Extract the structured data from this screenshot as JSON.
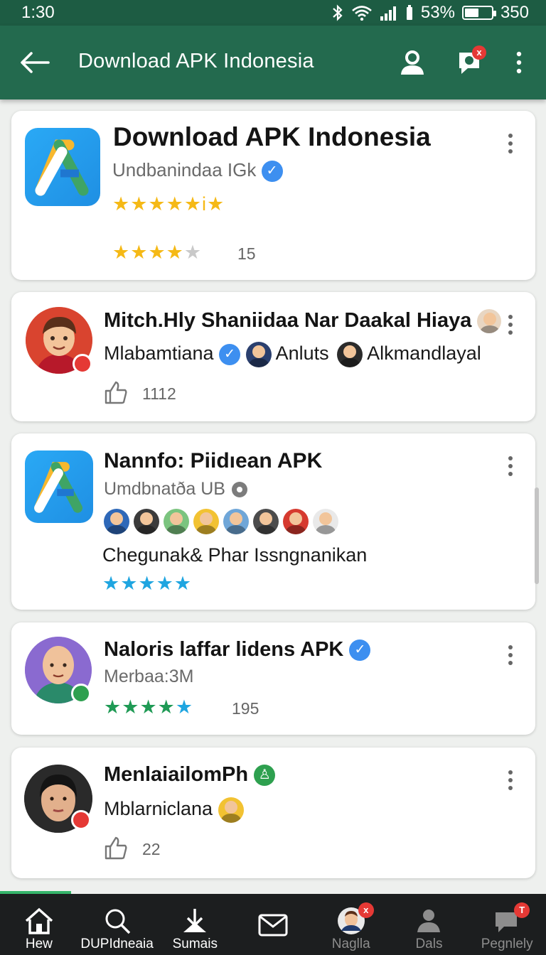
{
  "status_bar": {
    "time": "1:30",
    "battery_percent": "53%",
    "extra": "350",
    "battery_level": 0.53
  },
  "app_bar": {
    "title": "Download APK Indonesia"
  },
  "cards": [
    {
      "title": "Download APK Indonesia",
      "subtitle": "Undbanindaa IGk",
      "stars_top": "★★★★★i★",
      "rating_stars": 4,
      "rating_count": "15"
    },
    {
      "title": "Mitch.Hly Shaniidaa Nar Daakal Hiaya",
      "line2a": "Mlabamtiana",
      "line2b": "Anluts",
      "line2c": "Alkmandlayal",
      "likes": "1112"
    },
    {
      "title": "Nannfo: Piidıean APK",
      "subtitle": "Umdbnatða UB",
      "caption": "Chegunak& Phar Issngnanikan",
      "rating_stars": 5
    },
    {
      "title": "Naloris laffar lidens APK",
      "subtitle": "Merbaa:3M",
      "rating_stars": 5,
      "rating_count": "195"
    },
    {
      "title": "MenlaiailomPh",
      "subtitle": "Mblarniclana",
      "likes": "22"
    }
  ],
  "bottom_nav": [
    {
      "label": "Hew",
      "icon": "home-icon"
    },
    {
      "label": "DUPIdneaia",
      "icon": "search-icon"
    },
    {
      "label": "Sumais",
      "icon": "download-icon"
    },
    {
      "label": "",
      "icon": "mail-icon"
    },
    {
      "label": "Naglla",
      "icon": "profile-avatar-icon",
      "badge": "x"
    },
    {
      "label": "Dals",
      "icon": "person-icon"
    },
    {
      "label": "Pegnlely",
      "icon": "chat-icon",
      "badge": "T"
    }
  ],
  "colors": {
    "primary": "#236a4e",
    "status": "#1d5c43",
    "star_gold": "#f5b916",
    "star_blue": "#1fa5e0",
    "star_green": "#1f9a55",
    "verified": "#3d8ff0"
  }
}
